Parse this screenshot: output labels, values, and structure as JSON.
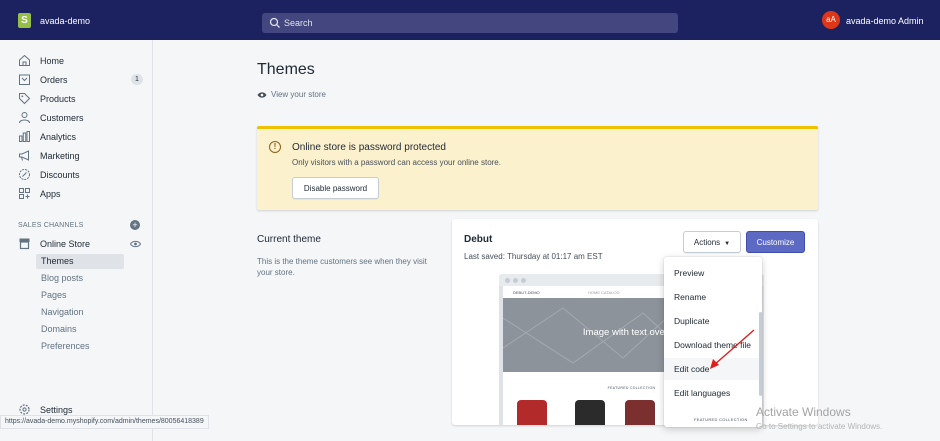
{
  "topbar": {
    "logo_letter": "S",
    "store_name": "avada-demo",
    "search_placeholder": "Search",
    "user_initials": "aA",
    "user_name": "avada-demo Admin"
  },
  "sidebar": {
    "items": [
      {
        "label": "Home",
        "icon": "home-icon"
      },
      {
        "label": "Orders",
        "icon": "orders-icon",
        "badge": "1"
      },
      {
        "label": "Products",
        "icon": "tag-icon"
      },
      {
        "label": "Customers",
        "icon": "person-icon"
      },
      {
        "label": "Analytics",
        "icon": "bar-chart-icon"
      },
      {
        "label": "Marketing",
        "icon": "megaphone-icon"
      },
      {
        "label": "Discounts",
        "icon": "discount-icon"
      },
      {
        "label": "Apps",
        "icon": "apps-icon"
      }
    ],
    "sales_channels_title": "SALES CHANNELS",
    "online_store_label": "Online Store",
    "sub_items": [
      "Themes",
      "Blog posts",
      "Pages",
      "Navigation",
      "Domains",
      "Preferences"
    ],
    "active_sub_item": "Themes",
    "settings_label": "Settings"
  },
  "status_bar_url": "https://avada-demo.myshopify.com/admin/themes/80056418389",
  "main": {
    "page_title": "Themes",
    "view_store": "View your store",
    "banner": {
      "title": "Online store is password protected",
      "text": "Only visitors with a password can access your online store.",
      "button": "Disable password"
    },
    "current_theme": {
      "title": "Current theme",
      "description": "This is the theme customers see when they visit your store."
    },
    "theme_card": {
      "name": "Debut",
      "last_saved": "Last saved: Thursday at 01:17 am EST",
      "actions_label": "Actions",
      "customize_label": "Customize",
      "preview_hero_title": "Image with text overlay",
      "preview_store_name": "DEBUT-DEMO",
      "preview_nav": "HOME   CATALOG",
      "preview_section": "FEATURED COLLECTION"
    },
    "actions_menu": [
      "Preview",
      "Rename",
      "Duplicate",
      "Download theme file",
      "Edit code",
      "Edit languages"
    ],
    "hovered_action": "Edit code",
    "footer_featured": "FEATURED COLLECTION"
  },
  "os_overlay": {
    "activate_title": "Activate Windows",
    "activate_sub": "Go to Settings to activate Windows."
  },
  "colors": {
    "topbar": "#1c2260",
    "primary_button": "#5c6ac4",
    "banner_bg": "#fcf1cd",
    "banner_border": "#eec200",
    "annotation_arrow": "#d9201c"
  }
}
